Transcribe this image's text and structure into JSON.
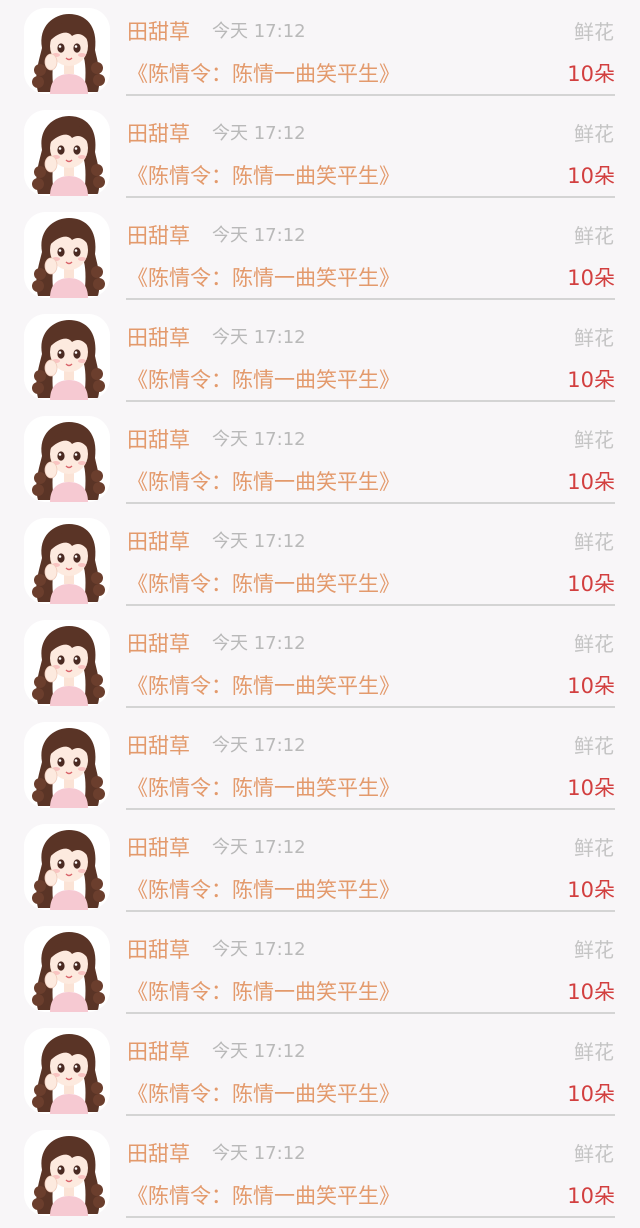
{
  "colors": {
    "background": "#f8f6f8",
    "name": "#e39a6c",
    "title": "#e39a6c",
    "time": "#b9b9b9",
    "gift_label": "#c4c4c4",
    "count": "#d23f3f",
    "divider": "#d4d4d4"
  },
  "feed": {
    "items": [
      {
        "avatar_icon": "cartoon-girl-avatar-icon",
        "name": "田甜草",
        "time": "今天 17:12",
        "gift": "鲜花",
        "title": "《陈情令：陈情一曲笑平生》",
        "count": "10朵"
      },
      {
        "avatar_icon": "cartoon-girl-avatar-icon",
        "name": "田甜草",
        "time": "今天 17:12",
        "gift": "鲜花",
        "title": "《陈情令：陈情一曲笑平生》",
        "count": "10朵"
      },
      {
        "avatar_icon": "cartoon-girl-avatar-icon",
        "name": "田甜草",
        "time": "今天 17:12",
        "gift": "鲜花",
        "title": "《陈情令：陈情一曲笑平生》",
        "count": "10朵"
      },
      {
        "avatar_icon": "cartoon-girl-avatar-icon",
        "name": "田甜草",
        "time": "今天 17:12",
        "gift": "鲜花",
        "title": "《陈情令：陈情一曲笑平生》",
        "count": "10朵"
      },
      {
        "avatar_icon": "cartoon-girl-avatar-icon",
        "name": "田甜草",
        "time": "今天 17:12",
        "gift": "鲜花",
        "title": "《陈情令：陈情一曲笑平生》",
        "count": "10朵"
      },
      {
        "avatar_icon": "cartoon-girl-avatar-icon",
        "name": "田甜草",
        "time": "今天 17:12",
        "gift": "鲜花",
        "title": "《陈情令：陈情一曲笑平生》",
        "count": "10朵"
      },
      {
        "avatar_icon": "cartoon-girl-avatar-icon",
        "name": "田甜草",
        "time": "今天 17:12",
        "gift": "鲜花",
        "title": "《陈情令：陈情一曲笑平生》",
        "count": "10朵"
      },
      {
        "avatar_icon": "cartoon-girl-avatar-icon",
        "name": "田甜草",
        "time": "今天 17:12",
        "gift": "鲜花",
        "title": "《陈情令：陈情一曲笑平生》",
        "count": "10朵"
      },
      {
        "avatar_icon": "cartoon-girl-avatar-icon",
        "name": "田甜草",
        "time": "今天 17:12",
        "gift": "鲜花",
        "title": "《陈情令：陈情一曲笑平生》",
        "count": "10朵"
      },
      {
        "avatar_icon": "cartoon-girl-avatar-icon",
        "name": "田甜草",
        "time": "今天 17:12",
        "gift": "鲜花",
        "title": "《陈情令：陈情一曲笑平生》",
        "count": "10朵"
      },
      {
        "avatar_icon": "cartoon-girl-avatar-icon",
        "name": "田甜草",
        "time": "今天 17:12",
        "gift": "鲜花",
        "title": "《陈情令：陈情一曲笑平生》",
        "count": "10朵"
      },
      {
        "avatar_icon": "cartoon-girl-avatar-icon",
        "name": "田甜草",
        "time": "今天 17:12",
        "gift": "鲜花",
        "title": "《陈情令：陈情一曲笑平生》",
        "count": "10朵"
      }
    ]
  }
}
